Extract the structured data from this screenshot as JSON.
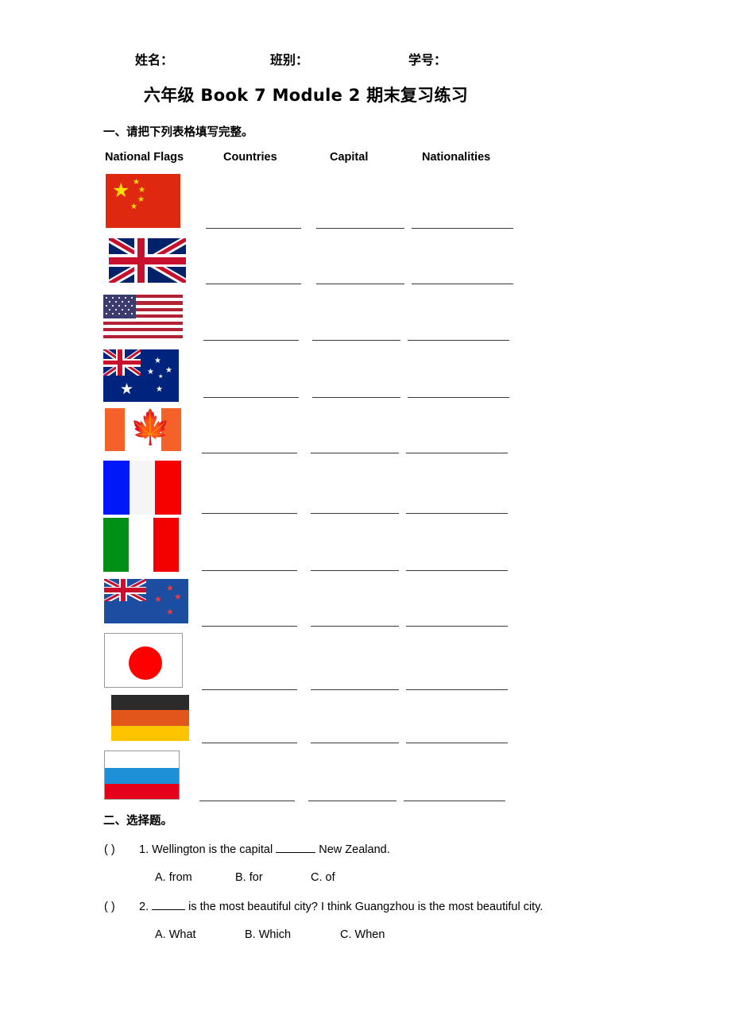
{
  "header": {
    "fields": [
      "姓名：",
      "班别：",
      "学号："
    ]
  },
  "title": "六年级 Book 7 Module 2  期末复习练习",
  "sections": {
    "one": "一、请把下列表格填写完整。",
    "two": "二、选择题。"
  },
  "table": {
    "columns": [
      "National Flags",
      "Countries",
      "Capital",
      "Nationalities"
    ],
    "rows": [
      {
        "flag": "flag-china",
        "country": "",
        "capital": "",
        "nationality": ""
      },
      {
        "flag": "flag-united-kingdom",
        "country": "",
        "capital": "",
        "nationality": ""
      },
      {
        "flag": "flag-usa",
        "country": "",
        "capital": "",
        "nationality": ""
      },
      {
        "flag": "flag-australia",
        "country": "",
        "capital": "",
        "nationality": ""
      },
      {
        "flag": "flag-canada",
        "country": "",
        "capital": "",
        "nationality": ""
      },
      {
        "flag": "flag-france",
        "country": "",
        "capital": "",
        "nationality": ""
      },
      {
        "flag": "flag-italy",
        "country": "",
        "capital": "",
        "nationality": ""
      },
      {
        "flag": "flag-new-zealand",
        "country": "",
        "capital": "",
        "nationality": ""
      },
      {
        "flag": "flag-japan",
        "country": "",
        "capital": "",
        "nationality": ""
      },
      {
        "flag": "flag-germany",
        "country": "",
        "capital": "",
        "nationality": ""
      },
      {
        "flag": "flag-russia",
        "country": "",
        "capital": "",
        "nationality": ""
      }
    ]
  },
  "questions": [
    {
      "paren": "(      )",
      "number": "1.",
      "text_before": "Wellington is the capital",
      "text_after": "New Zealand.",
      "options": [
        "A. from",
        "B. for",
        "C. of"
      ]
    },
    {
      "paren": "(      )",
      "number": "2.",
      "text_before": "",
      "text_after": "is the most beautiful city? I think Guangzhou is the most beautiful city.",
      "options": [
        "A. What",
        "B. Which",
        "C. When"
      ]
    }
  ],
  "colors": {
    "china_red": "#de2910",
    "china_yellow": "#ffde00",
    "uk_blue": "#012169",
    "uk_red": "#c8102e",
    "usa_blue": "#3c3b6e",
    "usa_red": "#b22234",
    "canada_red": "#f4622a",
    "france_blue": "#0018f7",
    "italy_green": "#009018",
    "japan_red": "#ff0000",
    "germany_gold": "#ffc400",
    "russia_blue": "#1e90d8",
    "line_color": "#3a3a3a"
  }
}
